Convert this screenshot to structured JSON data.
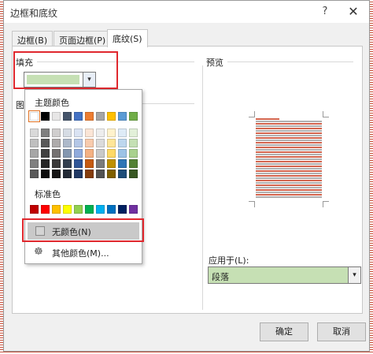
{
  "window": {
    "title": "边框和底纹",
    "help": "?",
    "close": "✕"
  },
  "tabs": [
    {
      "label": "边框(B)"
    },
    {
      "label": "页面边框(P)"
    },
    {
      "label": "底纹(S)"
    }
  ],
  "fill": {
    "label": "填充",
    "color": "#c6e0b4",
    "arrow": "▾"
  },
  "pattern": {
    "label": "图"
  },
  "dropdown": {
    "theme_heading": "主题颜色",
    "standard_heading": "标准色",
    "no_color": "无颜色(N)",
    "more_colors": "其他颜色(M)...",
    "theme_colors": [
      [
        "#ffffff",
        "#d9d9d9",
        "#bfbfbf",
        "#a6a6a6",
        "#808080",
        "#595959"
      ],
      [
        "#000000",
        "#7f7f7f",
        "#595959",
        "#404040",
        "#262626",
        "#0d0d0d"
      ],
      [
        "#e7e6e6",
        "#d0cece",
        "#aeabab",
        "#757171",
        "#3a3838",
        "#171616"
      ],
      [
        "#44546a",
        "#d6dce4",
        "#adb9ca",
        "#8497b0",
        "#333f4f",
        "#222a35"
      ],
      [
        "#4472c4",
        "#dae3f3",
        "#b4c7e7",
        "#8faadc",
        "#2f5597",
        "#203864"
      ],
      [
        "#ed7d31",
        "#fbe5d6",
        "#f8cbad",
        "#f4b183",
        "#c55a11",
        "#843c0c"
      ],
      [
        "#a5a5a5",
        "#ededed",
        "#dbdbdb",
        "#c9c9c9",
        "#7b7b7b",
        "#525252"
      ],
      [
        "#ffc000",
        "#fff2cc",
        "#ffe699",
        "#ffd966",
        "#bf9000",
        "#7f6000"
      ],
      [
        "#5b9bd5",
        "#deebf7",
        "#bdd7ee",
        "#9dc3e6",
        "#2e75b6",
        "#1f4e79"
      ],
      [
        "#70ad47",
        "#e2f0d9",
        "#c5e0b4",
        "#a9d18e",
        "#548235",
        "#385723"
      ]
    ],
    "standard_colors": [
      "#c00000",
      "#ff0000",
      "#ffc000",
      "#ffff00",
      "#92d050",
      "#00b050",
      "#00b0f0",
      "#0070c0",
      "#002060",
      "#7030a0"
    ]
  },
  "preview": {
    "label": "预览"
  },
  "apply_to": {
    "label": "应用于(L):",
    "value": "段落",
    "arrow": "▾"
  },
  "buttons": {
    "ok": "确定",
    "cancel": "取消"
  }
}
